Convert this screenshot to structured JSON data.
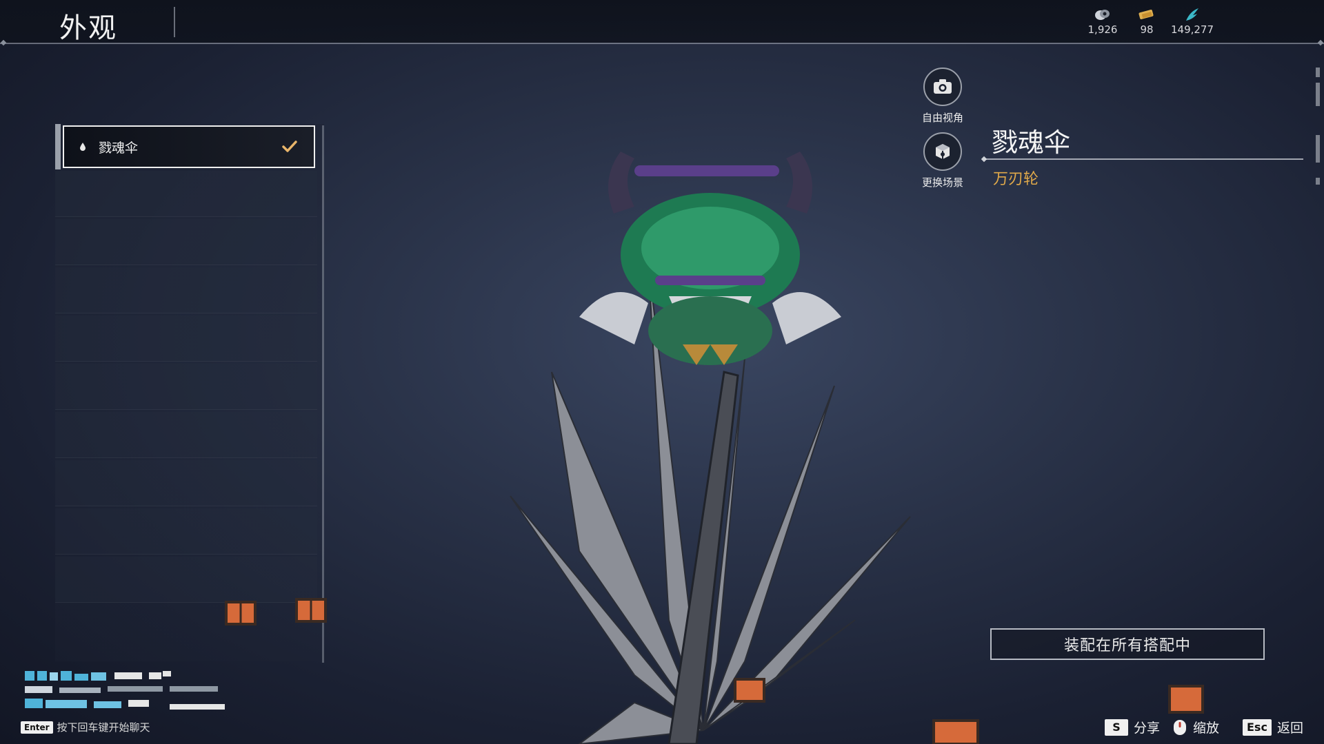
{
  "header": {
    "title": "外观",
    "currencies": [
      {
        "icon": "coin-stack-icon",
        "value": "1,926"
      },
      {
        "icon": "ticket-icon",
        "value": "98"
      },
      {
        "icon": "feather-icon",
        "value": "149,277"
      }
    ]
  },
  "list": {
    "items": [
      {
        "label": "戮魂伞",
        "selected": true,
        "equipped": true
      }
    ]
  },
  "tools": {
    "free_view": "自由视角",
    "change_scene": "更换场景"
  },
  "detail": {
    "name": "戮魂伞",
    "type": "万刃轮"
  },
  "actions": {
    "equip_all": "装配在所有搭配中"
  },
  "footer": {
    "chat_key": "Enter",
    "chat_hint": "按下回车键开始聊天",
    "share_key": "S",
    "share_label": "分享",
    "zoom_label": "缩放",
    "back_key": "Esc",
    "back_label": "返回"
  },
  "colors": {
    "accent_gold": "#e0a94a",
    "check_gold": "#e8b56a"
  }
}
